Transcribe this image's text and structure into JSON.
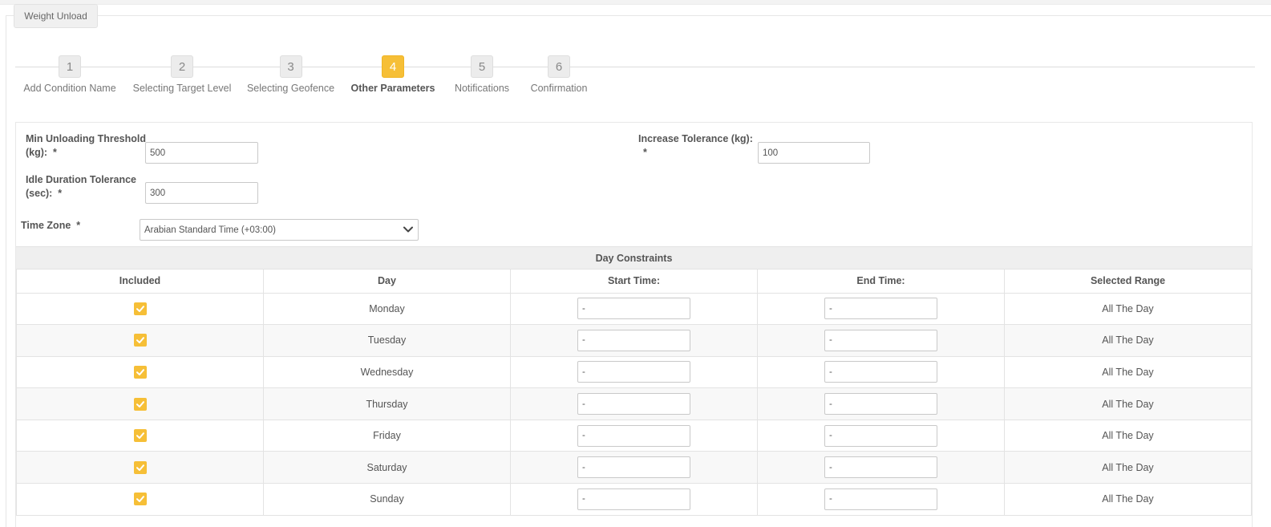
{
  "tab": {
    "title": "Weight Unload"
  },
  "wizard": {
    "steps": [
      {
        "num": "1",
        "label": "Add Condition Name"
      },
      {
        "num": "2",
        "label": "Selecting Target Level"
      },
      {
        "num": "3",
        "label": "Selecting Geofence"
      },
      {
        "num": "4",
        "label": "Other Parameters"
      },
      {
        "num": "5",
        "label": "Notifications"
      },
      {
        "num": "6",
        "label": "Confirmation"
      }
    ],
    "active_step": "4"
  },
  "form": {
    "min_unloading": {
      "label_line1": "Min Unloading Threshold",
      "label_line2": "(kg):  *",
      "value": "500"
    },
    "idle_duration": {
      "label_line1": "Idle Duration Tolerance",
      "label_line2": "(sec):  *",
      "value": "300"
    },
    "increase_tolerance": {
      "label_line1": "Increase Tolerance (kg):",
      "label_line2": "*",
      "value": "100"
    },
    "time_zone": {
      "label": "Time Zone  *",
      "value": "Arabian Standard Time (+03:00)"
    }
  },
  "day_constraints": {
    "title": "Day Constraints",
    "columns": [
      "Included",
      "Day",
      "Start Time:",
      "End Time:",
      "Selected Range"
    ],
    "rows": [
      {
        "included": true,
        "day": "Monday",
        "start": "-",
        "end": "-",
        "range": "All The Day"
      },
      {
        "included": true,
        "day": "Tuesday",
        "start": "-",
        "end": "-",
        "range": "All The Day"
      },
      {
        "included": true,
        "day": "Wednesday",
        "start": "-",
        "end": "-",
        "range": "All The Day"
      },
      {
        "included": true,
        "day": "Thursday",
        "start": "-",
        "end": "-",
        "range": "All The Day"
      },
      {
        "included": true,
        "day": "Friday",
        "start": "-",
        "end": "-",
        "range": "All The Day"
      },
      {
        "included": true,
        "day": "Saturday",
        "start": "-",
        "end": "-",
        "range": "All The Day"
      },
      {
        "included": true,
        "day": "Sunday",
        "start": "-",
        "end": "-",
        "range": "All The Day"
      }
    ]
  },
  "colors": {
    "accent": "#f6bf37",
    "border": "#c9c9c9",
    "header_bg": "#efefef"
  },
  "icons": {
    "checkbox": "check-icon",
    "select": "chevron-down-icon"
  }
}
